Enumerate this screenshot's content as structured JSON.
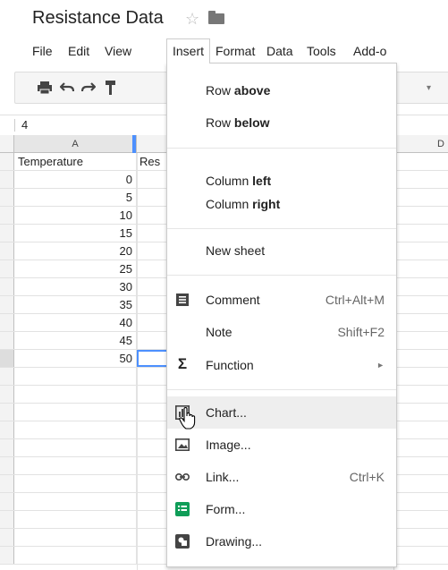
{
  "doc": {
    "title": "Resistance Data"
  },
  "menubar": [
    "File",
    "Edit",
    "View",
    "Insert",
    "Format",
    "Data",
    "Tools",
    "Add-o"
  ],
  "formula_bar": {
    "value": "4"
  },
  "columns": [
    "A",
    "D"
  ],
  "cells": {
    "header_a": "Temperature",
    "header_b": "Res",
    "values": [
      "0",
      "5",
      "10",
      "15",
      "20",
      "25",
      "30",
      "35",
      "40",
      "45",
      "50"
    ]
  },
  "insert_menu": {
    "row_above_prefix": "Row ",
    "row_above_bold": "above",
    "row_below_prefix": "Row ",
    "row_below_bold": "below",
    "column_left_prefix": "Column ",
    "column_left_bold": "left",
    "column_right_prefix": "Column ",
    "column_right_bold": "right",
    "new_sheet": "New sheet",
    "comment": "Comment",
    "comment_shortcut": "Ctrl+Alt+M",
    "note": "Note",
    "note_shortcut": "Shift+F2",
    "function": "Function",
    "function_arrow": "►",
    "chart": "Chart...",
    "image": "Image...",
    "link": "Link...",
    "link_shortcut": "Ctrl+K",
    "form": "Form...",
    "drawing": "Drawing..."
  },
  "icons": {
    "sigma": "Σ",
    "star": "☆"
  },
  "colors": {
    "selection": "#4d90fe",
    "form_green": "#0f9d58",
    "menu_hover": "#eeeeee"
  }
}
